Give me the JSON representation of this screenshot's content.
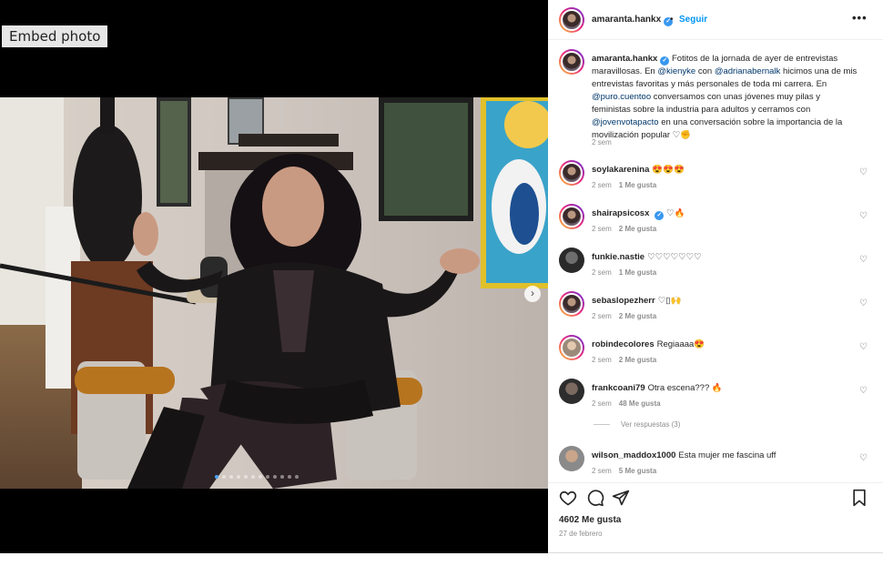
{
  "embed_label": "Embed photo",
  "post": {
    "username": "amaranta.hankx",
    "separator": "•",
    "follow_label": "Seguir",
    "more_label": "•••",
    "caption_user": "amaranta.hankx",
    "caption_parts": {
      "p1": "Fotitos de la jornada de ayer de entrevistas maravillosas. En ",
      "m1": "@kienyke",
      "p2": " con ",
      "m2": "@adrianabernalk",
      "p3": " hicimos una de mis entrevistas favoritas y más personales de toda mi carrera. En ",
      "m3": "@puro.cuentoo",
      "p4": " conversamos con unas jóvenes muy pilas y feministas sobre la industria para adultos y cerramos con ",
      "m4": "@jovenvotapacto",
      "p5": " en una conversación sobre la importancia de la movilización popular ♡✊"
    },
    "caption_time": "2 sem",
    "likes": "4602 Me gusta",
    "date": "27 de febrero"
  },
  "comments": [
    {
      "user": "soylakarenina",
      "text": "😍😍😍",
      "time": "2 sem",
      "likes": "1 Me gusta",
      "verified": false
    },
    {
      "user": "shairapsicosx",
      "text": "♡🔥",
      "time": "2 sem",
      "likes": "2 Me gusta",
      "verified": true
    },
    {
      "user": "funkie.nastie",
      "text": "♡♡♡♡♡♡♡",
      "time": "2 sem",
      "likes": "1 Me gusta",
      "verified": false
    },
    {
      "user": "sebaslopezherr",
      "text": "♡▯🙌",
      "time": "2 sem",
      "likes": "2 Me gusta",
      "verified": false
    },
    {
      "user": "robindecolores",
      "text": "Regiaaaa😍",
      "time": "2 sem",
      "likes": "2 Me gusta",
      "verified": false
    },
    {
      "user": "frankcoani79",
      "text": "Otra escena??? 🔥",
      "time": "2 sem",
      "likes": "48 Me gusta",
      "verified": false
    },
    {
      "user": "wilson_maddox1000",
      "text": "Esta mujer me fascina uff",
      "time": "2 sem",
      "likes": "5 Me gusta",
      "verified": false
    }
  ],
  "view_replies": "Ver respuestas (3)",
  "carousel": {
    "total": 12,
    "current": 1,
    "next_symbol": "›"
  },
  "icons": {
    "like": "heart-icon",
    "comment": "comment-icon",
    "share": "share-icon",
    "save": "bookmark-icon",
    "comment_like": "small-heart-icon",
    "verified": "verified-badge-icon"
  },
  "colors": {
    "link": "#00376b",
    "follow": "#0095f6",
    "verified": "#3897f0",
    "muted": "#8e8e8e",
    "carousel_active_dot": "#4da3ff"
  }
}
